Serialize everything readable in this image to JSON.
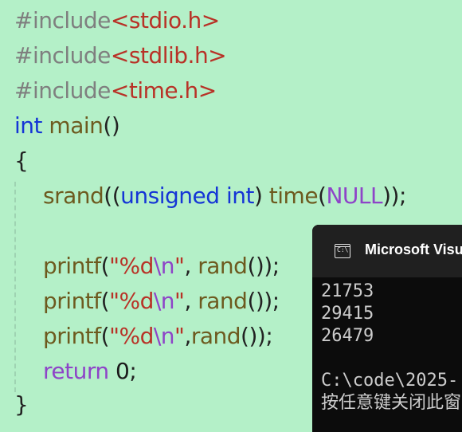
{
  "editor": {
    "line1": {
      "directive": "#include",
      "header": "<stdio.h>"
    },
    "line2": {
      "directive": "#include",
      "header": "<stdlib.h>"
    },
    "line3": {
      "directive": "#include",
      "header": "<time.h>"
    },
    "line4": {
      "type": "int",
      "name": "main",
      "parens": "()"
    },
    "line5": {
      "brace": "{"
    },
    "line6": {
      "fn": "srand",
      "open": "((",
      "kw1": "unsigned",
      "kw2": "int",
      "close1": ") ",
      "fn2": "time",
      "open2": "(",
      "macro": "NULL",
      "close2": "));"
    },
    "line8": {
      "fn": "printf",
      "open": "(",
      "str": "\"%d",
      "esc": "\\n",
      "strend": "\"",
      "sep": ", ",
      "fn2": "rand",
      "close": "());"
    },
    "line9": {
      "fn": "printf",
      "open": "(",
      "str": "\"%d",
      "esc": "\\n",
      "strend": "\"",
      "sep": ", ",
      "fn2": "rand",
      "close": "());"
    },
    "line10": {
      "fn": "printf",
      "open": "(",
      "str": "\"%d",
      "esc": "\\n",
      "strend": "\"",
      "sep": ",",
      "fn2": "rand",
      "close": "());"
    },
    "line11": {
      "kw": "return",
      "val": "0",
      "semi": ";"
    },
    "line12": {
      "brace": "}"
    }
  },
  "console": {
    "title": "Microsoft Visual Studio Debug Console",
    "icon": "terminal-icon",
    "lines": [
      "21753",
      "29415",
      "26479",
      "",
      "C:\\code\\2025-",
      "按任意键关闭此窗口"
    ]
  },
  "colors": {
    "background": "#b4f0c8",
    "keyword": "#1535d6",
    "string": "#b83227",
    "macro": "#8e44c8",
    "console_bg": "#0c0c0c"
  }
}
